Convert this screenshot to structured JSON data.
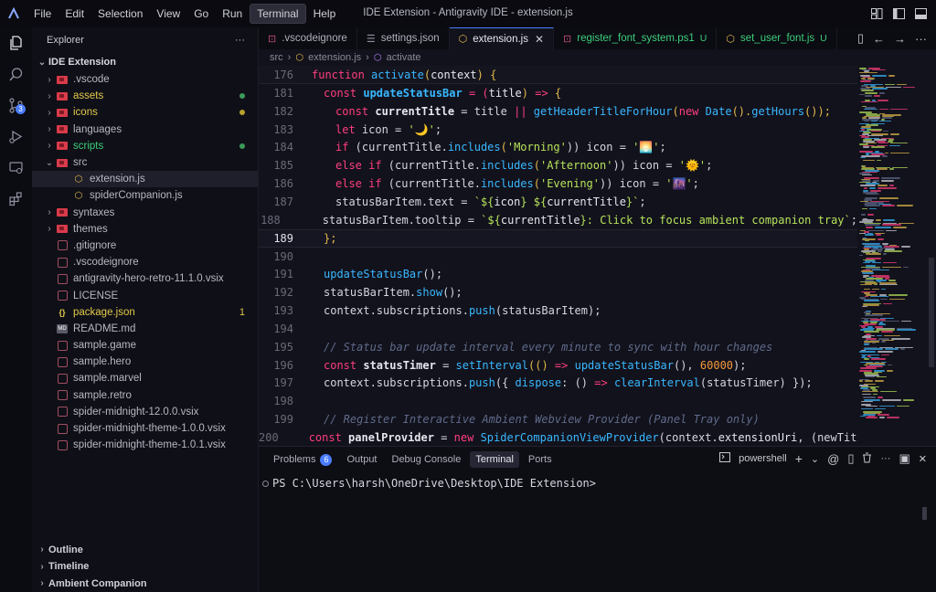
{
  "window": {
    "title": "IDE Extension - Antigravity IDE - extension.js",
    "logo": "antigravity-logo"
  },
  "menu": [
    "File",
    "Edit",
    "Selection",
    "View",
    "Go",
    "Run",
    "Terminal",
    "Help"
  ],
  "activity": [
    "files-icon",
    "search-icon",
    "source-control-icon",
    "run-debug-icon",
    "remote-icon",
    "extensions-icon"
  ],
  "activity_badge": "3",
  "sidebar": {
    "header": "Explorer",
    "more": "···",
    "section": "IDE Extension",
    "tree": [
      {
        "label": ".vscode",
        "type": "folder",
        "indent": 1,
        "chev": "›"
      },
      {
        "label": "assets",
        "type": "folder-red",
        "indent": 1,
        "chev": "›",
        "color": "#e2c94a",
        "dot": "#3c9a5a"
      },
      {
        "label": "icons",
        "type": "folder-red",
        "indent": 1,
        "chev": "›",
        "color": "#e2c94a",
        "dot": "#b8a030"
      },
      {
        "label": "languages",
        "type": "folder",
        "indent": 1,
        "chev": "›"
      },
      {
        "label": "scripts",
        "type": "folder-red",
        "indent": 1,
        "chev": "›",
        "color": "#3ccf7a",
        "dot": "#3c9a5a"
      },
      {
        "label": "src",
        "type": "folder",
        "indent": 1,
        "chev": "⌄"
      },
      {
        "label": "extension.js",
        "type": "js",
        "indent": 2,
        "selected": true
      },
      {
        "label": "spiderCompanion.js",
        "type": "js",
        "indent": 2
      },
      {
        "label": "syntaxes",
        "type": "folder-red",
        "indent": 1,
        "chev": "›"
      },
      {
        "label": "themes",
        "type": "folder-red",
        "indent": 1,
        "chev": "›"
      },
      {
        "label": ".gitignore",
        "type": "file",
        "indent": 1
      },
      {
        "label": ".vscodeignore",
        "type": "file",
        "indent": 1
      },
      {
        "label": "antigravity-hero-retro-11.1.0.vsix",
        "type": "file",
        "indent": 1
      },
      {
        "label": "LICENSE",
        "type": "file",
        "indent": 1
      },
      {
        "label": "package.json",
        "type": "json",
        "indent": 1,
        "color": "#e2c94a",
        "count": "1"
      },
      {
        "label": "README.md",
        "type": "md",
        "indent": 1
      },
      {
        "label": "sample.game",
        "type": "file",
        "indent": 1
      },
      {
        "label": "sample.hero",
        "type": "file",
        "indent": 1
      },
      {
        "label": "sample.marvel",
        "type": "file",
        "indent": 1
      },
      {
        "label": "sample.retro",
        "type": "file",
        "indent": 1
      },
      {
        "label": "spider-midnight-12.0.0.vsix",
        "type": "file",
        "indent": 1
      },
      {
        "label": "spider-midnight-theme-1.0.0.vsix",
        "type": "file",
        "indent": 1
      },
      {
        "label": "spider-midnight-theme-1.0.1.vsix",
        "type": "file",
        "indent": 1
      }
    ],
    "bottom": [
      "Outline",
      "Timeline",
      "Ambient Companion"
    ]
  },
  "tabs": [
    {
      "label": ".vscodeignore",
      "icon": "⊡",
      "iconColor": "#c05070"
    },
    {
      "label": "settings.json",
      "icon": "☰",
      "iconColor": "#9090a0"
    },
    {
      "label": "extension.js",
      "icon": "⬡",
      "iconColor": "#e2b94a",
      "active": true,
      "close": "✕"
    },
    {
      "label": "register_font_system.ps1",
      "icon": "⊡",
      "iconColor": "#c05070",
      "color": "#3ccf7a",
      "mod": "U"
    },
    {
      "label": "set_user_font.js",
      "icon": "⬡",
      "iconColor": "#e2b94a",
      "color": "#3ccf7a",
      "mod": "U"
    }
  ],
  "tab_actions": [
    "▯",
    "←",
    "→",
    "···"
  ],
  "breadcrumb": [
    "src",
    "extension.js",
    "activate"
  ],
  "editor": {
    "sticky": {
      "num": "176"
    },
    "current_line": "189",
    "lines": [
      {
        "num": "181",
        "indent": 1
      },
      {
        "num": "182",
        "indent": 2
      },
      {
        "num": "183",
        "indent": 2
      },
      {
        "num": "184",
        "indent": 2
      },
      {
        "num": "185",
        "indent": 2
      },
      {
        "num": "186",
        "indent": 2
      },
      {
        "num": "187",
        "indent": 2
      },
      {
        "num": "188",
        "indent": 2
      },
      {
        "num": "189",
        "indent": 1
      },
      {
        "num": "190",
        "indent": 0
      },
      {
        "num": "191",
        "indent": 1
      },
      {
        "num": "192",
        "indent": 1
      },
      {
        "num": "193",
        "indent": 1
      },
      {
        "num": "194",
        "indent": 0
      },
      {
        "num": "195",
        "indent": 1
      },
      {
        "num": "196",
        "indent": 1
      },
      {
        "num": "197",
        "indent": 1
      },
      {
        "num": "198",
        "indent": 0
      },
      {
        "num": "199",
        "indent": 1
      },
      {
        "num": "200",
        "indent": 1
      }
    ],
    "code": {
      "l176": [
        "function",
        "activate",
        "(",
        "context",
        ") {"
      ],
      "l181": [
        "const",
        "updateStatusBar",
        " = (",
        "title",
        ") ",
        "=>",
        " {"
      ],
      "l182": [
        "const",
        "currentTitle",
        " = title ",
        "||",
        " ",
        "getHeaderTitleForHour",
        "(",
        "new",
        " ",
        "Date",
        "().",
        "getHours",
        "());"
      ],
      "l183": [
        "let",
        " icon = ",
        "'🌙'",
        ";"
      ],
      "l184": [
        "if",
        " (currentTitle.",
        "includes",
        "(",
        "'Morning'",
        ")) icon = ",
        "'🌅'",
        ";"
      ],
      "l185": [
        "else if",
        " (currentTitle.",
        "includes",
        "(",
        "'Afternoon'",
        ")) icon = ",
        "'🌞'",
        ";"
      ],
      "l186": [
        "else if",
        " (currentTitle.",
        "includes",
        "(",
        "'Evening'",
        ")) icon = ",
        "'🌆'",
        ";"
      ],
      "l187": [
        "statusBarItem.text = ",
        "`${",
        "icon",
        "} ${",
        "currentTitle",
        "}`",
        ";"
      ],
      "l188": [
        "statusBarItem.tooltip = ",
        "`${",
        "currentTitle",
        "}: Click to focus ambient companion tray`",
        ";"
      ],
      "l189": [
        "};"
      ],
      "l191": [
        "updateStatusBar",
        "();"
      ],
      "l192": [
        "statusBarItem.",
        "show",
        "();"
      ],
      "l193": [
        "context.subscriptions.",
        "push",
        "(statusBarItem);"
      ],
      "l195": [
        "// Status bar update interval every minute to sync with hour changes"
      ],
      "l196": [
        "const",
        "statusTimer",
        " = ",
        "setInterval",
        "(() ",
        "=>",
        " ",
        "updateStatusBar",
        "(), ",
        "60000",
        ");"
      ],
      "l197": [
        "context.subscriptions.",
        "push",
        "({ ",
        "dispose",
        ": () ",
        "=>",
        " ",
        "clearInterval",
        "(statusTimer) });"
      ],
      "l199": [
        "// Register Interactive Ambient Webview Provider (Panel Tray only)"
      ],
      "l200": [
        "const",
        "panelProvider",
        " = ",
        "new",
        " ",
        "SpiderCompanionViewProvider",
        "(context.",
        "extensionUri",
        ", (newTitle) ",
        "=>",
        " {"
      ]
    }
  },
  "panel": {
    "tabs": [
      "Problems",
      "Output",
      "Debug Console",
      "Terminal",
      "Ports"
    ],
    "problems_count": "6",
    "shell": "powershell",
    "actions": [
      "+",
      "⌄",
      "@",
      "▯",
      "🗑",
      "···",
      "▣",
      "✕"
    ],
    "prompt": "PS C:\\Users\\harsh\\OneDrive\\Desktop\\IDE Extension>"
  },
  "colors": {
    "keyword": "#ff3e7f",
    "function": "#39b8ff",
    "string": "#b6e35a",
    "accent": "#4a7dff"
  }
}
